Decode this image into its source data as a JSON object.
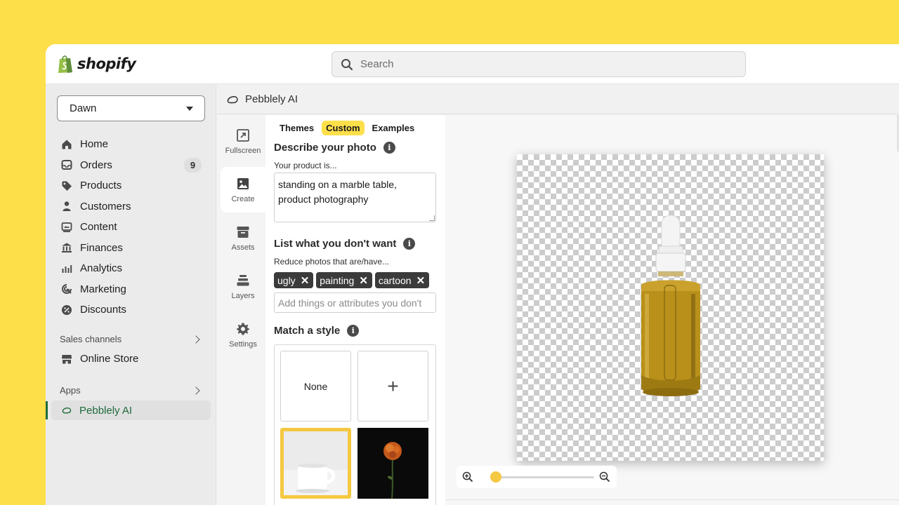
{
  "brand": {
    "name": "shopify"
  },
  "search": {
    "placeholder": "Search"
  },
  "sidebar": {
    "store": "Dawn",
    "items": [
      {
        "label": "Home",
        "icon": "home-icon"
      },
      {
        "label": "Orders",
        "icon": "orders-icon",
        "badge": "9"
      },
      {
        "label": "Products",
        "icon": "tag-icon"
      },
      {
        "label": "Customers",
        "icon": "person-icon"
      },
      {
        "label": "Content",
        "icon": "content-icon"
      },
      {
        "label": "Finances",
        "icon": "bank-icon"
      },
      {
        "label": "Analytics",
        "icon": "bar-chart-icon"
      },
      {
        "label": "Marketing",
        "icon": "target-icon"
      },
      {
        "label": "Discounts",
        "icon": "discount-icon"
      }
    ],
    "sales_channels": {
      "label": "Sales channels",
      "items": [
        {
          "label": "Online Store",
          "icon": "store-icon"
        }
      ]
    },
    "apps": {
      "label": "Apps",
      "items": [
        {
          "label": "Pebblely AI",
          "icon": "pebble-icon"
        }
      ]
    }
  },
  "app": {
    "title": "Pebblely AI"
  },
  "rail": {
    "items": [
      {
        "label": "Fullscreen",
        "icon": "fullscreen-icon"
      },
      {
        "label": "Create",
        "icon": "image-icon",
        "active": true
      },
      {
        "label": "Assets",
        "icon": "archive-icon"
      },
      {
        "label": "Layers",
        "icon": "layers-icon"
      },
      {
        "label": "Settings",
        "icon": "gear-icon"
      }
    ]
  },
  "panel": {
    "tabs": [
      "Themes",
      "Custom",
      "Examples"
    ],
    "active_tab": "Custom",
    "describe": {
      "heading": "Describe your photo",
      "label": "Your product is...",
      "value": "standing on a marble table, product photography"
    },
    "negative": {
      "heading": "List what you don't want",
      "label": "Reduce photos that are/have...",
      "chips": [
        "ugly",
        "painting",
        "cartoon"
      ],
      "placeholder": "Add things or attributes you don't"
    },
    "style": {
      "heading": "Match a style",
      "tiles": [
        "None",
        "+"
      ]
    }
  },
  "zoom": {
    "level": 0.0
  },
  "colors": {
    "accent": "#fddf4a",
    "active_nav": "#1f6b3a"
  }
}
